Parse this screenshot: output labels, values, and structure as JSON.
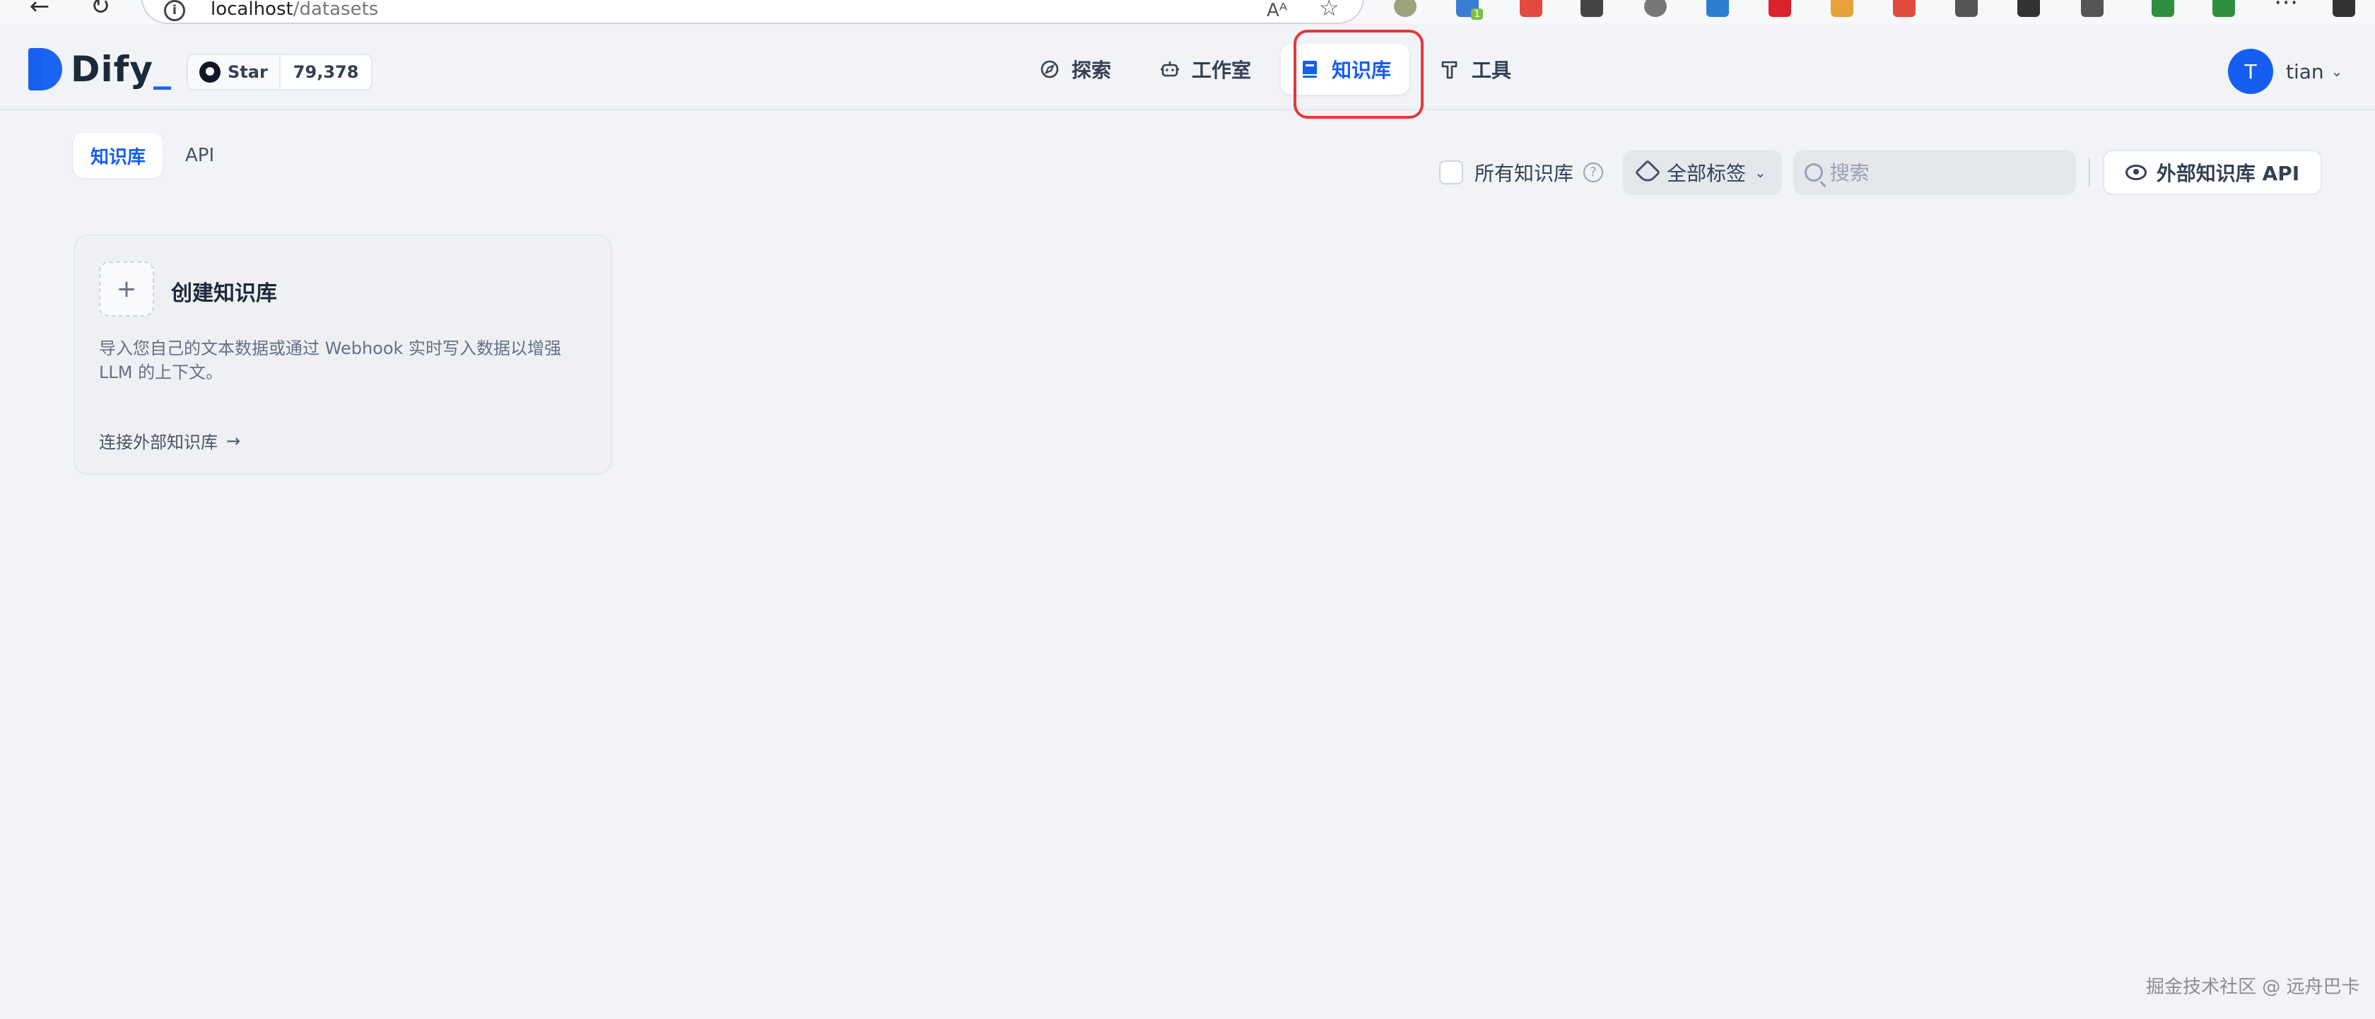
{
  "browser": {
    "url_host": "localhost",
    "url_path": "/datasets",
    "read_aloud_icon": "Aᴬ",
    "favorite_icon": "☆",
    "extension_badge": "1"
  },
  "header": {
    "logo_text": "Dify",
    "logo_suffix": "_",
    "github_star_label": "Star",
    "github_star_count": "79,378",
    "nav": [
      {
        "label": "探索",
        "icon": "compass-icon"
      },
      {
        "label": "工作室",
        "icon": "robot-icon"
      },
      {
        "label": "知识库",
        "icon": "book-icon",
        "active": true
      },
      {
        "label": "工具",
        "icon": "hammer-icon"
      }
    ],
    "user_initial": "T",
    "user_name": "tian"
  },
  "toolbar": {
    "tabs": [
      {
        "label": "知识库",
        "active": true
      },
      {
        "label": "API",
        "active": false
      }
    ],
    "all_knowledge_label": "所有知识库",
    "all_knowledge_checked": false,
    "tag_filter_label": "全部标签",
    "search_placeholder": "搜索",
    "search_value": "",
    "external_api_label": "外部知识库 API"
  },
  "create_card": {
    "title": "创建知识库",
    "description": "导入您自己的文本数据或通过 Webhook 实时写入数据以增强 LLM 的上下文。",
    "link_label": "连接外部知识库"
  },
  "watermark": "掘金技术社区 @ 远舟巴卡",
  "colors": {
    "accent": "#155eef",
    "highlight": "#e5373c",
    "background": "#f1f3f7"
  }
}
